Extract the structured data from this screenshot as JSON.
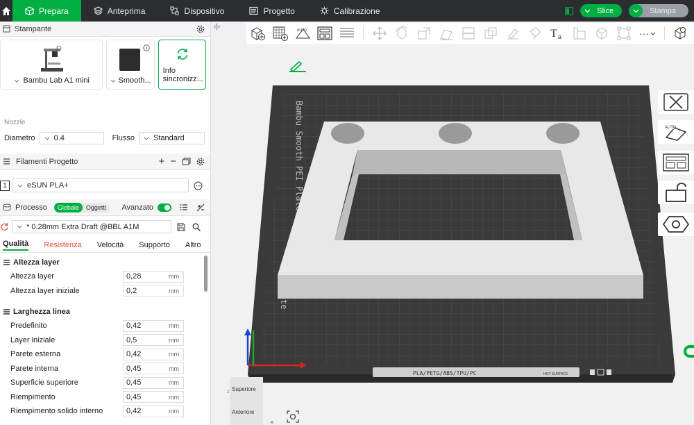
{
  "topbar": {
    "tabs": [
      {
        "label": "Prepara",
        "active": true
      },
      {
        "label": "Anteprima"
      },
      {
        "label": "Dispositivo"
      },
      {
        "label": "Progetto"
      },
      {
        "label": "Calibrazione"
      }
    ],
    "slice_label": "Slice",
    "print_label": "Stampa"
  },
  "printer": {
    "section_title": "Stampante",
    "printer_name": "Bambu Lab A1 mini",
    "plate_name": "Smooth...",
    "sync_label_1": "Info",
    "sync_label_2": "sincronizz...",
    "nozzle_label": "Nozzle",
    "diameter_label": "Diametro",
    "diameter_value": "0.4",
    "flow_label": "Flusso",
    "flow_value": "Standard"
  },
  "filaments": {
    "section_title": "Filamenti Progetto",
    "slot_number": "1",
    "filament_name": "eSUN PLA+"
  },
  "process": {
    "section_title": "Processo",
    "toggle_global": "Globale",
    "toggle_objects": "Oggetti",
    "advanced_label": "Avanzato",
    "profile_name": "* 0.28mm Extra Draft @BBL A1M",
    "tabs": [
      "Qualità",
      "Resistenza",
      "Velocità",
      "Supporto",
      "Altro"
    ],
    "groups": {
      "layer_height": {
        "title": "Altezza layer",
        "params": [
          {
            "label": "Altezza layer",
            "value": "0,28",
            "unit": "mm"
          },
          {
            "label": "Altezza layer iniziale",
            "value": "0,2",
            "unit": "mm"
          }
        ]
      },
      "line_width": {
        "title": "Larghezza linea",
        "params": [
          {
            "label": "Predefinito",
            "value": "0,42",
            "unit": "mm"
          },
          {
            "label": "Layer iniziale",
            "value": "0,5",
            "unit": "mm"
          },
          {
            "label": "Parete esterna",
            "value": "0,42",
            "unit": "mm"
          },
          {
            "label": "Parete interna",
            "value": "0,45",
            "unit": "mm"
          },
          {
            "label": "Superficie superiore",
            "value": "0,45",
            "unit": "mm"
          },
          {
            "label": "Riempimento",
            "value": "0,45",
            "unit": "mm"
          },
          {
            "label": "Riempimento solido interno",
            "value": "0,42",
            "unit": "mm"
          }
        ]
      }
    }
  },
  "viewport": {
    "plate_label": "Bambu Smooth PEI Plate A1 mi",
    "plate_label_tail": "te",
    "material_strip": "PLA/PETG/ABS/TPU/PC",
    "hot_surface": "HOT SURFACE",
    "view_top": "Superiore",
    "view_front": "Anteriore",
    "toolbar_auto": "AUTO",
    "more_label": "···"
  },
  "colors": {
    "accent": "#00ae42",
    "topbar_bg": "#2b2d30",
    "plate_bg": "#3a3a3a",
    "model": "#dcdcdc"
  }
}
